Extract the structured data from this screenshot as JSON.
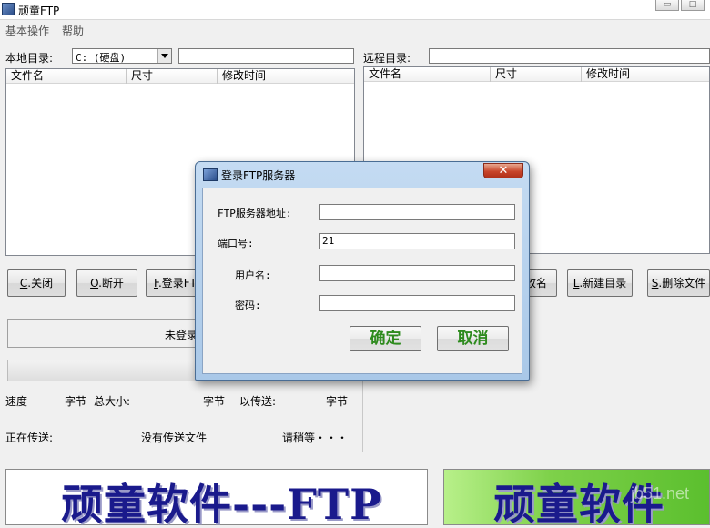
{
  "window": {
    "title": "顽童FTP",
    "minimize": "▭",
    "maximize": "□"
  },
  "menu": [
    "基本操作",
    "帮助"
  ],
  "local": {
    "dir_label": "本地目录:",
    "drive_value": "C: (硬盘)",
    "columns": [
      "文件名",
      "尺寸",
      "修改时间"
    ]
  },
  "remote": {
    "dir_label": "远程目录:",
    "columns": [
      "文件名",
      "尺寸",
      "修改时间"
    ]
  },
  "buttons": {
    "close": {
      "key": "C",
      "label": ".关闭"
    },
    "disconnect": {
      "key": "O",
      "label": ".断开"
    },
    "login": {
      "key": "F",
      "label": ".登录FTP"
    },
    "rename": {
      "label": "改名"
    },
    "new_dir": {
      "key": "L",
      "label": ".新建目录"
    },
    "delete_file": {
      "key": "S",
      "label": ".删除文件"
    }
  },
  "status": {
    "login_state": "未登录",
    "progress": 0,
    "speed_label": "速度",
    "bytes_unit_1": "字节",
    "total_size_label": "总大小:",
    "bytes_unit_2": "字节",
    "sent_label": "以传送:",
    "bytes_unit_3": "字节",
    "transferring_label": "正在传送:",
    "no_file": "没有传送文件",
    "wait": "请稍等・・・"
  },
  "banners": {
    "left": "顽童软件---FTP",
    "right": "顽童软件",
    "watermark": "jb51.net"
  },
  "dialog": {
    "title": "登录FTP服务器",
    "close_glyph": "✕",
    "server_label": "FTP服务器地址:",
    "server_value": "",
    "port_label": "端口号:",
    "port_value": "21",
    "user_label": "用户名:",
    "user_value": "",
    "password_label": "密码:",
    "password_value": "",
    "ok": "确定",
    "cancel": "取消"
  },
  "colors": {
    "banner_text": "#1a1a8c",
    "dialog_button_text": "#2e8b1e",
    "banner_green": "#5bbf2e"
  }
}
